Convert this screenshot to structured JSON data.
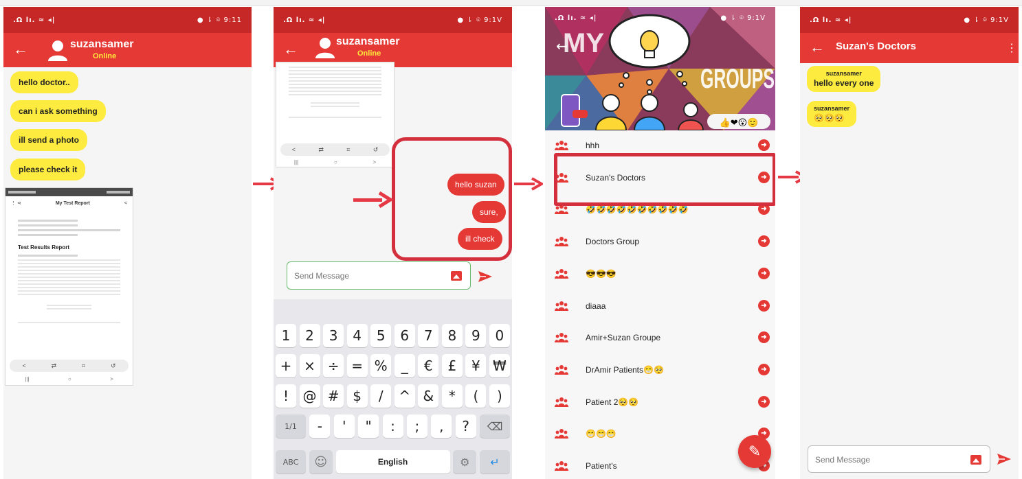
{
  "panel1": {
    "status_left": ".Ω lı. ≈ ◂|",
    "status_right": "● ⇂ ⌾ 9:11",
    "user_name": "suzansamer",
    "user_status": "Online",
    "messages": [
      "hello doctor..",
      "can i ask something",
      "ill send a photo",
      "please check it"
    ],
    "report": {
      "header_title": "My Test Report",
      "heading": "Test Results Report",
      "nav": [
        "<",
        "⇄",
        "⌗",
        "↺"
      ],
      "sys": [
        "|||",
        "○",
        ">"
      ]
    }
  },
  "panel2": {
    "status_left": ".Ω lı. ≈ ◂|",
    "status_right": "● ⇂ ⌾ 9:1V",
    "user_name": "suzansamer",
    "user_status": "Online",
    "sent": [
      "hello suzan",
      "sure,",
      "ill check"
    ],
    "compose_placeholder": "Send Message",
    "keyboard": {
      "row1": [
        "1",
        "2",
        "3",
        "4",
        "5",
        "6",
        "7",
        "8",
        "9",
        "0"
      ],
      "row2": [
        "+",
        "×",
        "÷",
        "=",
        "%",
        "_",
        "€",
        "£",
        "¥",
        "₩"
      ],
      "row3": [
        "!",
        "@",
        "#",
        "$",
        "/",
        "^",
        "&",
        "*",
        "(",
        ")"
      ],
      "row4": [
        "1/1",
        "-",
        "'",
        "\"",
        ":",
        ";",
        ",",
        "?",
        "⌫"
      ],
      "abc": "ABC",
      "emoji": "☺",
      "space": "English",
      "settings": "⚙",
      "enter": "↵"
    }
  },
  "panel3": {
    "status_left": ".Ω lı. ≈ ◂|",
    "status_right": "● ⇂ ⌾ 9:1V",
    "banner_my": "MY",
    "banner_groups": "GROUPS",
    "banner_emojis": "👍❤😮🙂",
    "groups": [
      "hhh",
      "Suzan's Doctors",
      "🤣🤣🤣🤣🤣🤣🤣🤣🤣🤣",
      "Doctors Group",
      "😎😎😎",
      "diaaa",
      "Amir+Suzan Groupe",
      "DrAmir Patients😁🥺",
      "Patient 2🥺🥺",
      "😁😁😁",
      "Patient's"
    ],
    "fab_icon": "✎"
  },
  "panel4": {
    "status_left": ".Ω lı. ≈ ◂|",
    "status_right": "● ⇂ ⌾ 9:1V",
    "title": "Suzan's Doctors",
    "messages": [
      {
        "sender": "suzansamer",
        "text": "hello every one"
      },
      {
        "sender": "suzansamer",
        "text": "🥺🥺🥺"
      }
    ],
    "compose_placeholder": "Send Message"
  },
  "colors": {
    "status_bar": "#c62828",
    "app_bar": "#e53935",
    "incoming_bubble": "#fdec3f",
    "outgoing_bubble": "#e53935",
    "highlight": "#d32f3c"
  }
}
